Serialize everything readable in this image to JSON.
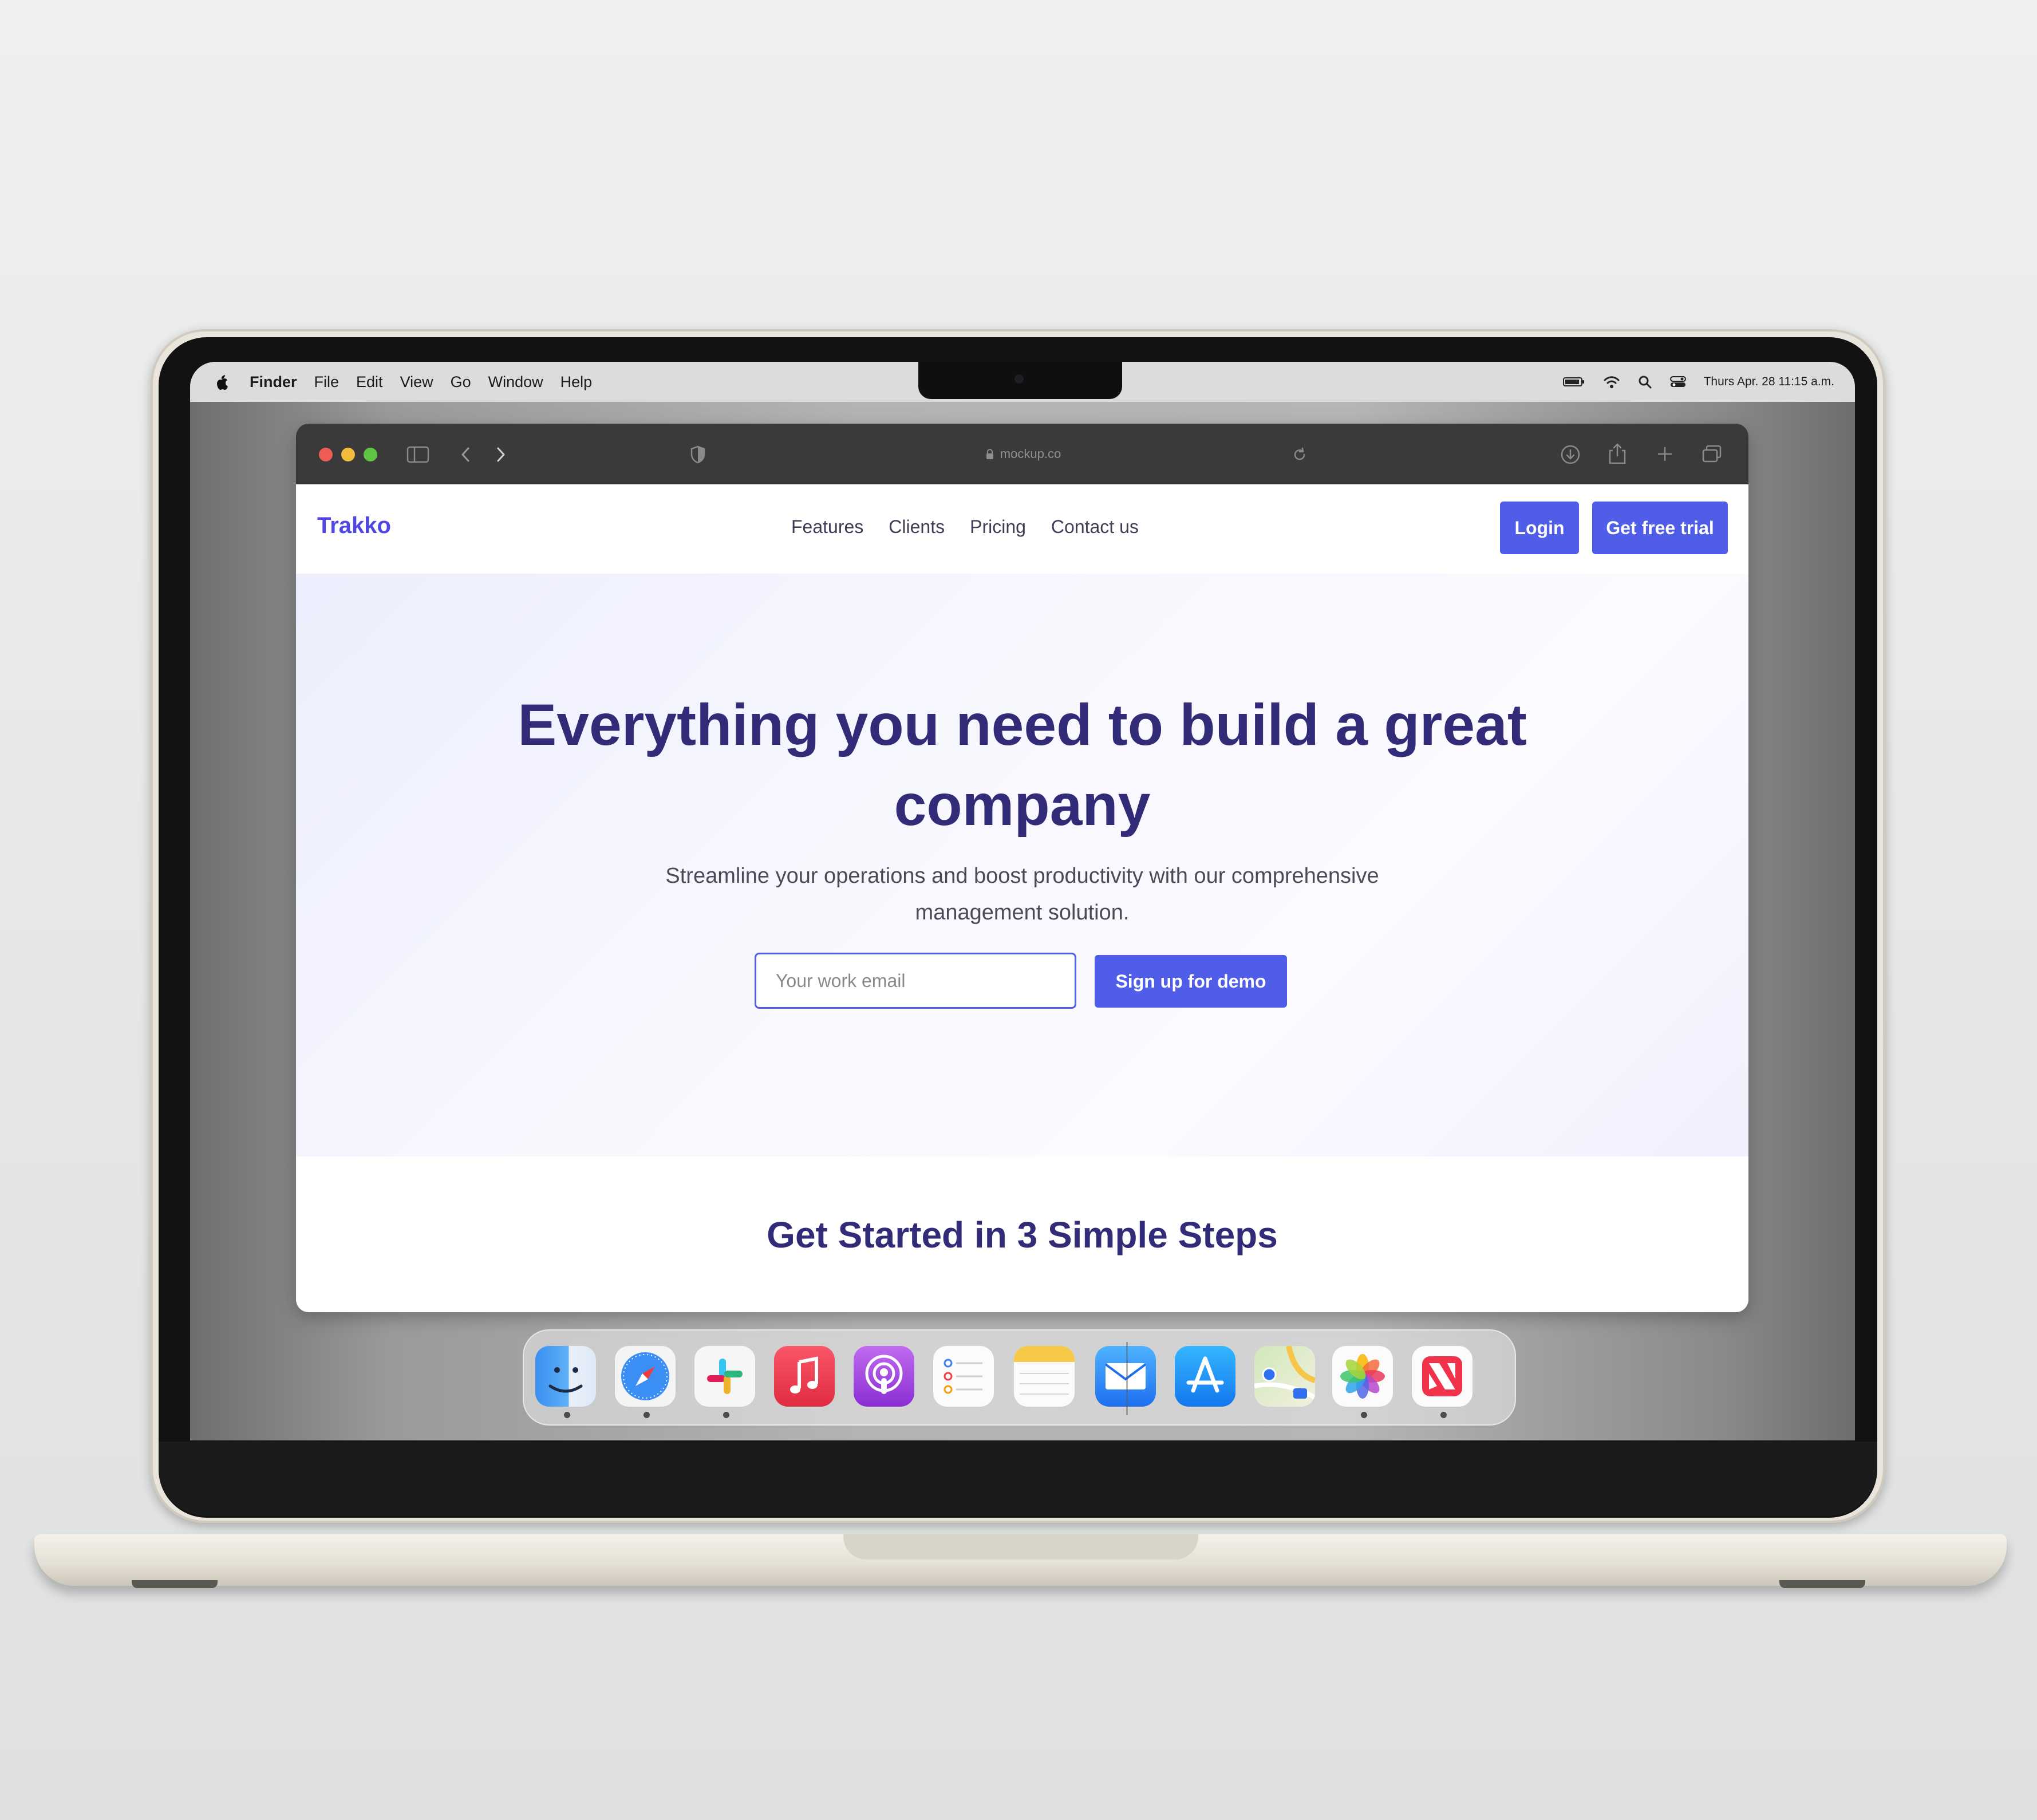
{
  "menubar": {
    "app_name": "Finder",
    "menus": [
      "File",
      "Edit",
      "View",
      "Go",
      "Window",
      "Help"
    ],
    "datetime": "Thurs Apr. 28 11:15 a.m."
  },
  "browser": {
    "address": "mockup.co"
  },
  "site": {
    "logo": "Trakko",
    "nav": [
      "Features",
      "Clients",
      "Pricing",
      "Contact us"
    ],
    "login_label": "Login",
    "trial_label": "Get free trial",
    "hero_title": "Everything you need to build a great company",
    "hero_subtitle": "Streamline your operations and boost productivity with our comprehensive management solution.",
    "email_placeholder": "Your work email",
    "demo_label": "Sign up for demo",
    "steps_title": "Get Started in 3 Simple Steps",
    "accent_color": "#4f5de8",
    "heading_color": "#322b78"
  },
  "dock": {
    "apps": [
      "Finder",
      "Safari",
      "Slack",
      "Music",
      "Podcasts",
      "Reminders",
      "Notes",
      "Mail",
      "App Store",
      "Maps",
      "Photos",
      "News"
    ]
  }
}
